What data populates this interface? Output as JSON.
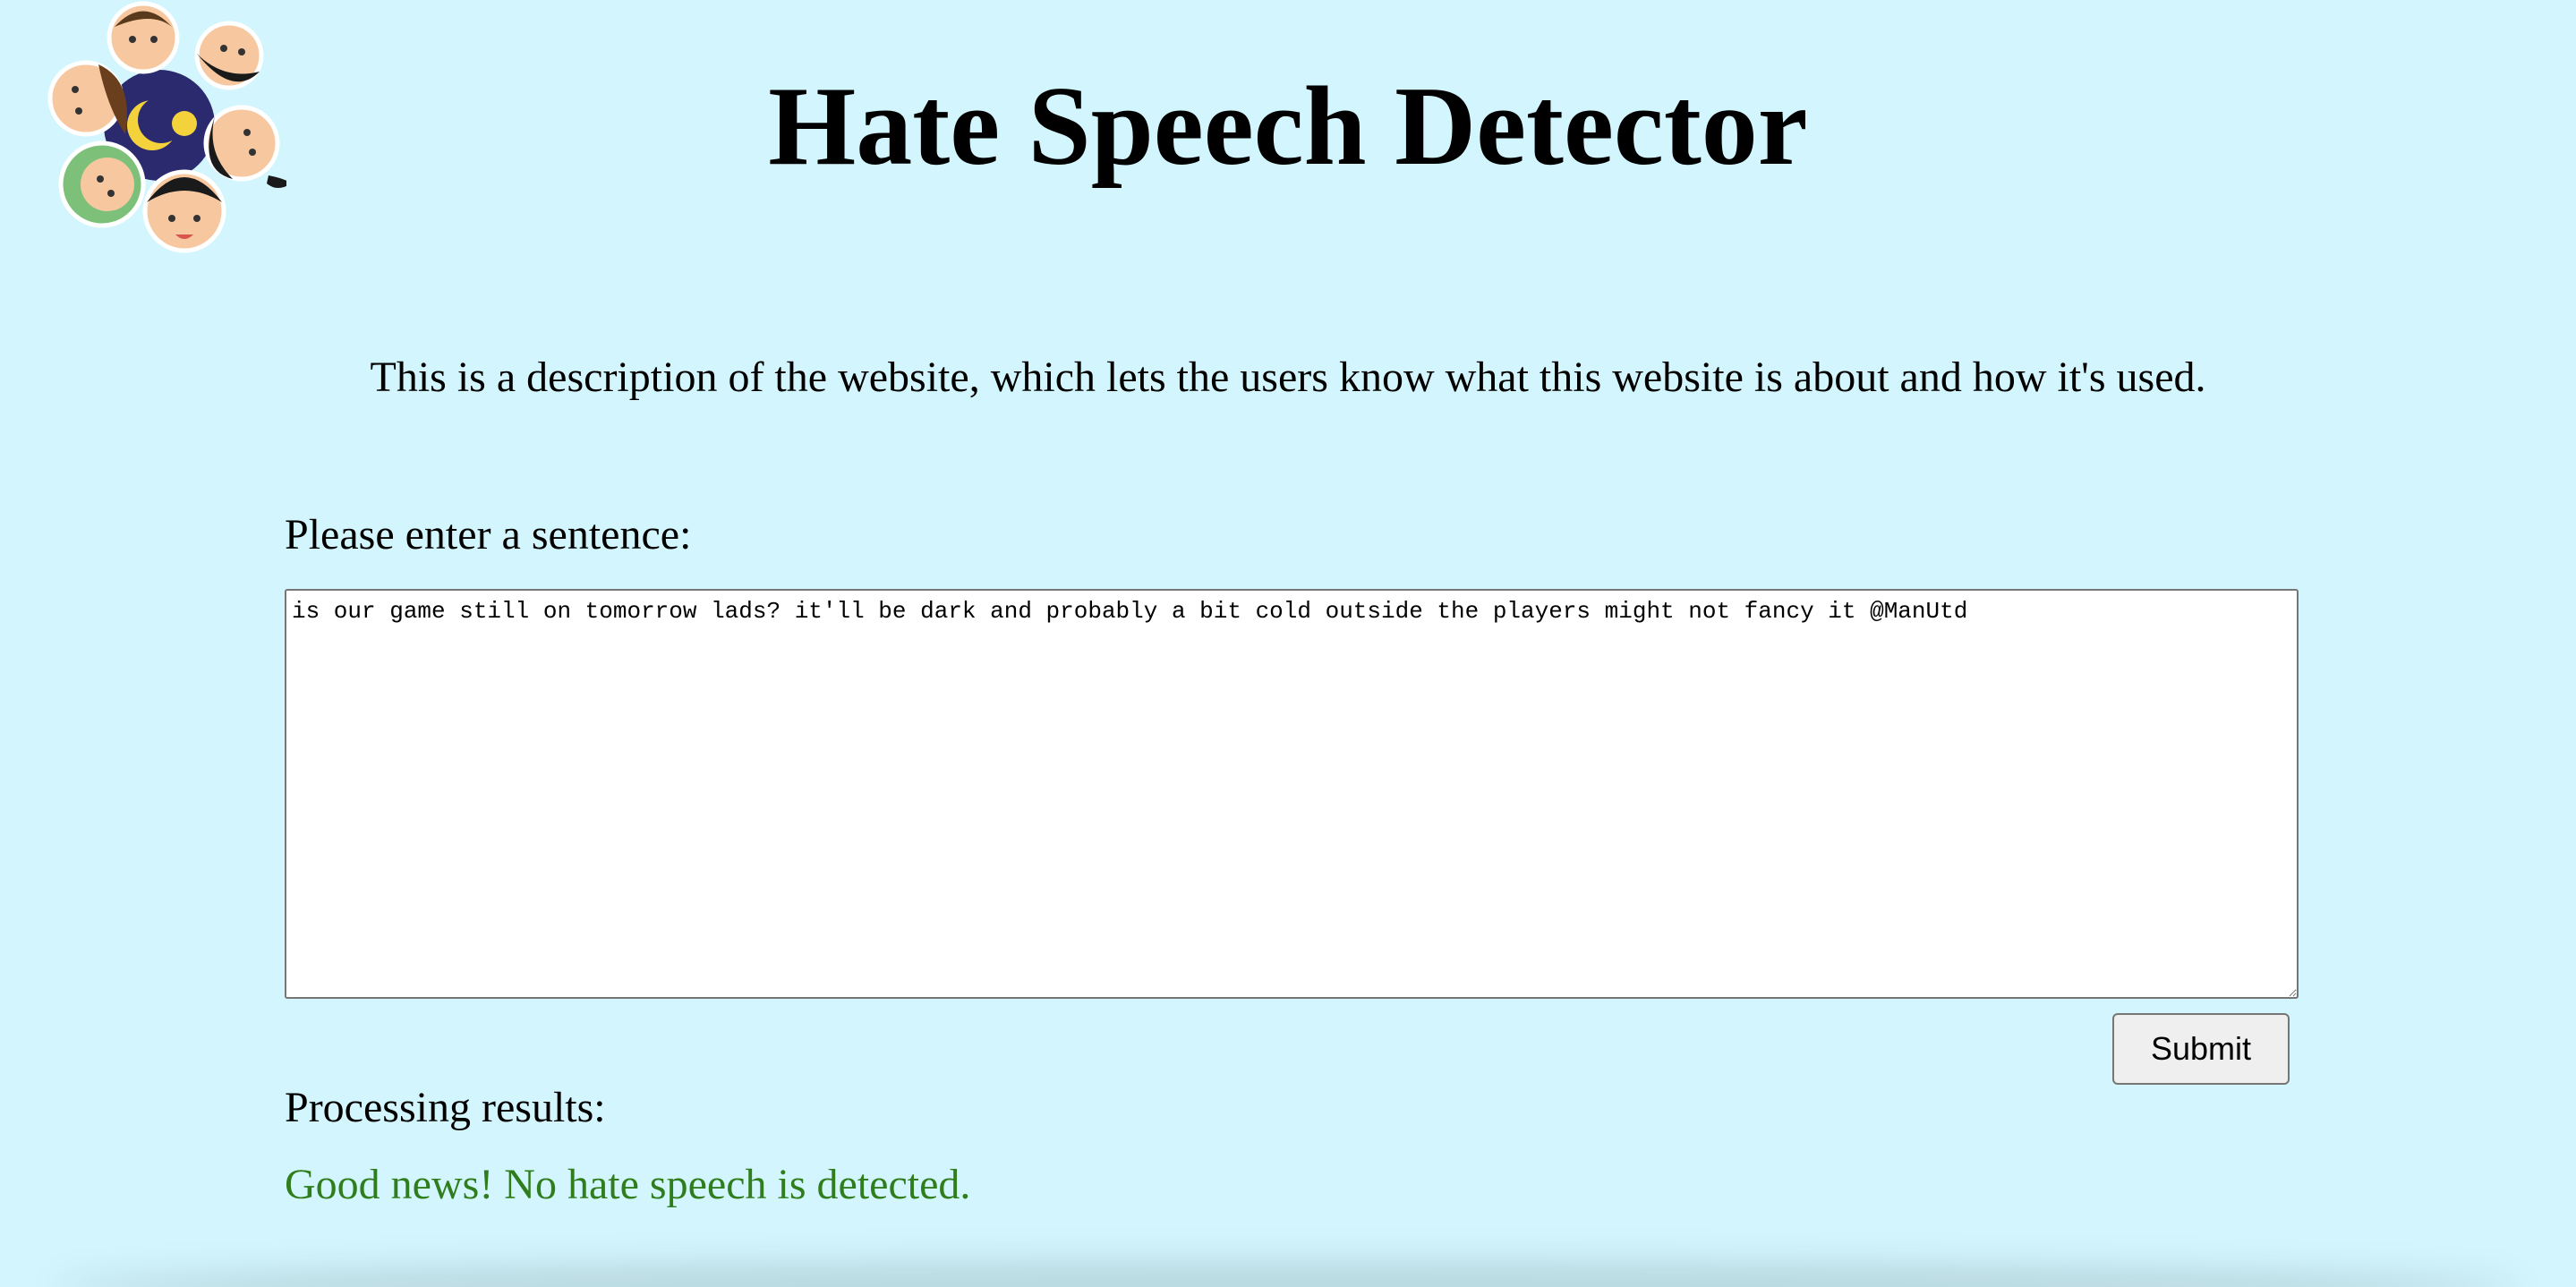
{
  "header": {
    "title": "Hate Speech Detector",
    "logo_icon": "children-faces-circle-logo-icon"
  },
  "main": {
    "description": "This is a description of the website, which lets the users know what this website is about and how it's used.",
    "prompt_label": "Please enter a sentence:",
    "sentence_value": "is our game still on tomorrow lads? it'll be dark and probably a bit cold outside the players might not fancy it @ManUtd",
    "submit_label": "Submit",
    "results_label": "Processing results:",
    "result_message": "Good news! No hate speech is detected."
  },
  "colors": {
    "background": "#d3f6fe",
    "result_text": "#2f7d1c"
  }
}
